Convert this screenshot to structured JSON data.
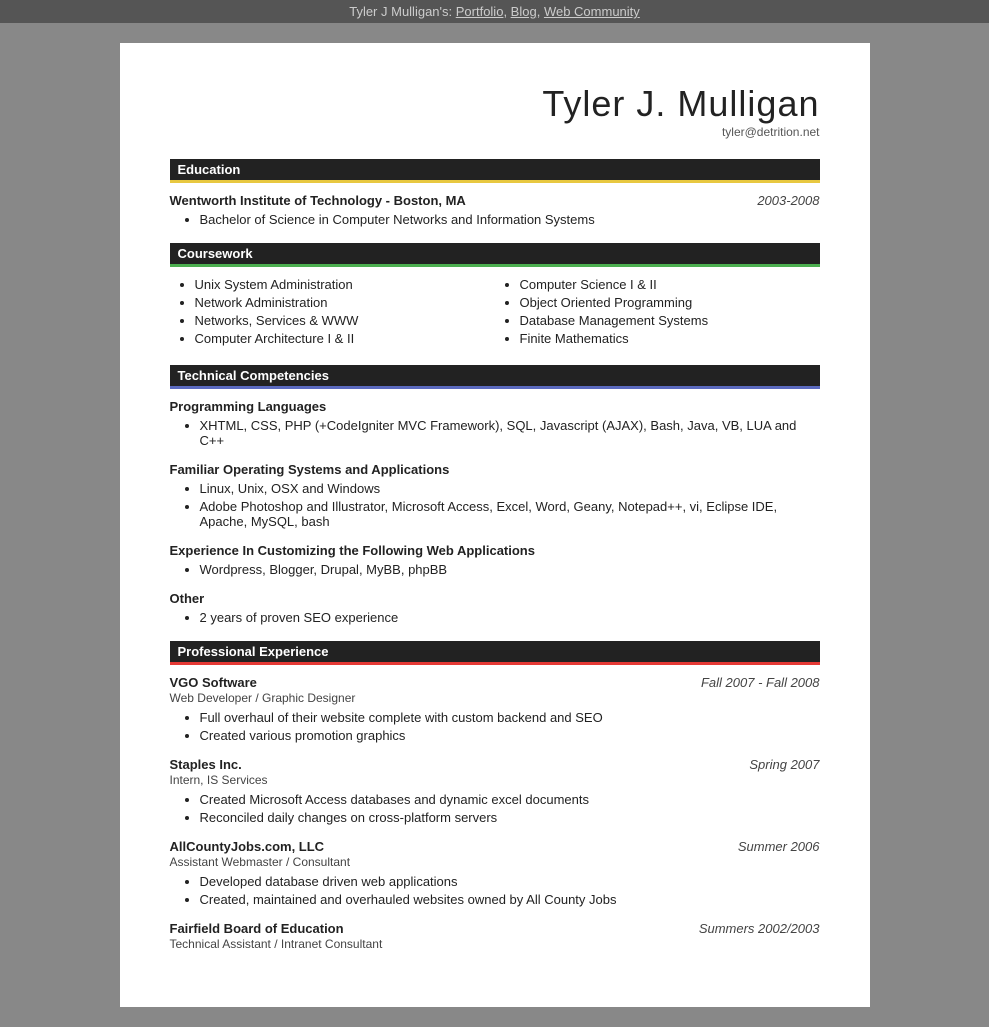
{
  "topbar": {
    "text": "Tyler J Mulligan's: ",
    "links": [
      "Portfolio",
      "Blog",
      "Web Community"
    ]
  },
  "header": {
    "name": "Tyler J. Mulligan",
    "email": "tyler@detrition.net"
  },
  "sections": {
    "education": {
      "label": "Education",
      "institution": "Wentworth Institute of Technology - Boston, MA",
      "dates": "2003-2008",
      "degree": "Bachelor of Science in Computer Networks and Information Systems"
    },
    "coursework": {
      "label": "Coursework",
      "col1": [
        "Unix System Administration",
        "Network Administration",
        "Networks, Services & WWW",
        "Computer Architecture I & II"
      ],
      "col2": [
        "Computer Science I & II",
        "Object Oriented Programming",
        "Database Management Systems",
        "Finite Mathematics"
      ]
    },
    "technical": {
      "label": "Technical Competencies",
      "subsections": [
        {
          "title": "Programming Languages",
          "items": [
            "XHTML, CSS, PHP (+CodeIgniter MVC Framework), SQL, Javascript (AJAX), Bash, Java, VB, LUA and C++"
          ]
        },
        {
          "title": "Familiar Operating Systems and Applications",
          "items": [
            "Linux, Unix, OSX and Windows",
            "Adobe Photoshop and Illustrator, Microsoft Access, Excel, Word, Geany, Notepad++, vi, Eclipse IDE, Apache, MySQL, bash"
          ]
        },
        {
          "title": "Experience In Customizing the Following Web Applications",
          "items": [
            "Wordpress, Blogger, Drupal, MyBB, phpBB"
          ]
        },
        {
          "title": "Other",
          "items": [
            "2 years of proven SEO experience"
          ]
        }
      ]
    },
    "professional": {
      "label": "Professional Experience",
      "jobs": [
        {
          "company": "VGO Software",
          "dates": "Fall 2007 - Fall 2008",
          "subtitle": "Web Developer / Graphic Designer",
          "items": [
            "Full overhaul of their website complete with custom backend and SEO",
            "Created various promotion graphics"
          ]
        },
        {
          "company": "Staples Inc.",
          "dates": "Spring 2007",
          "subtitle": "Intern, IS Services",
          "items": [
            "Created Microsoft Access databases and dynamic excel documents",
            "Reconciled daily changes on cross-platform servers"
          ]
        },
        {
          "company": "AllCountyJobs.com, LLC",
          "dates": "Summer 2006",
          "subtitle": "Assistant Webmaster / Consultant",
          "items": [
            "Developed database driven web applications",
            "Created, maintained and overhauled websites owned by All County Jobs"
          ]
        },
        {
          "company": "Fairfield Board of Education",
          "dates": "Summers 2002/2003",
          "subtitle": "Technical Assistant / Intranet Consultant",
          "items": []
        }
      ]
    }
  }
}
